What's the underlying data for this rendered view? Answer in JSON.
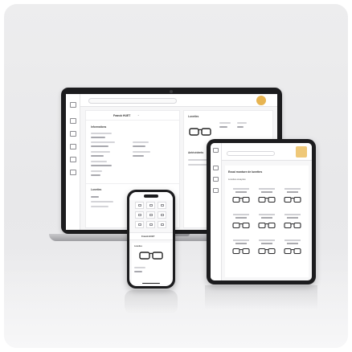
{
  "laptop": {
    "patient_name": "Franck HUET",
    "patient_suffix": "⌄",
    "sections": {
      "info": "Informations",
      "lunettes": "Lunettes",
      "remarks": "Antécédents"
    }
  },
  "tablet": {
    "title": "Essai monture de lunettes",
    "subtitle": "Lunettes essayées"
  },
  "phone": {
    "patient_name": "Franck HUET",
    "section": "Lunettes"
  },
  "colors": {
    "brand_accent": "#e7b451",
    "device_frame": "#1c1c1e",
    "background": "#ececee"
  },
  "icons": [
    "glasses-icon",
    "search-icon",
    "logo-mark",
    "grid-icon"
  ]
}
